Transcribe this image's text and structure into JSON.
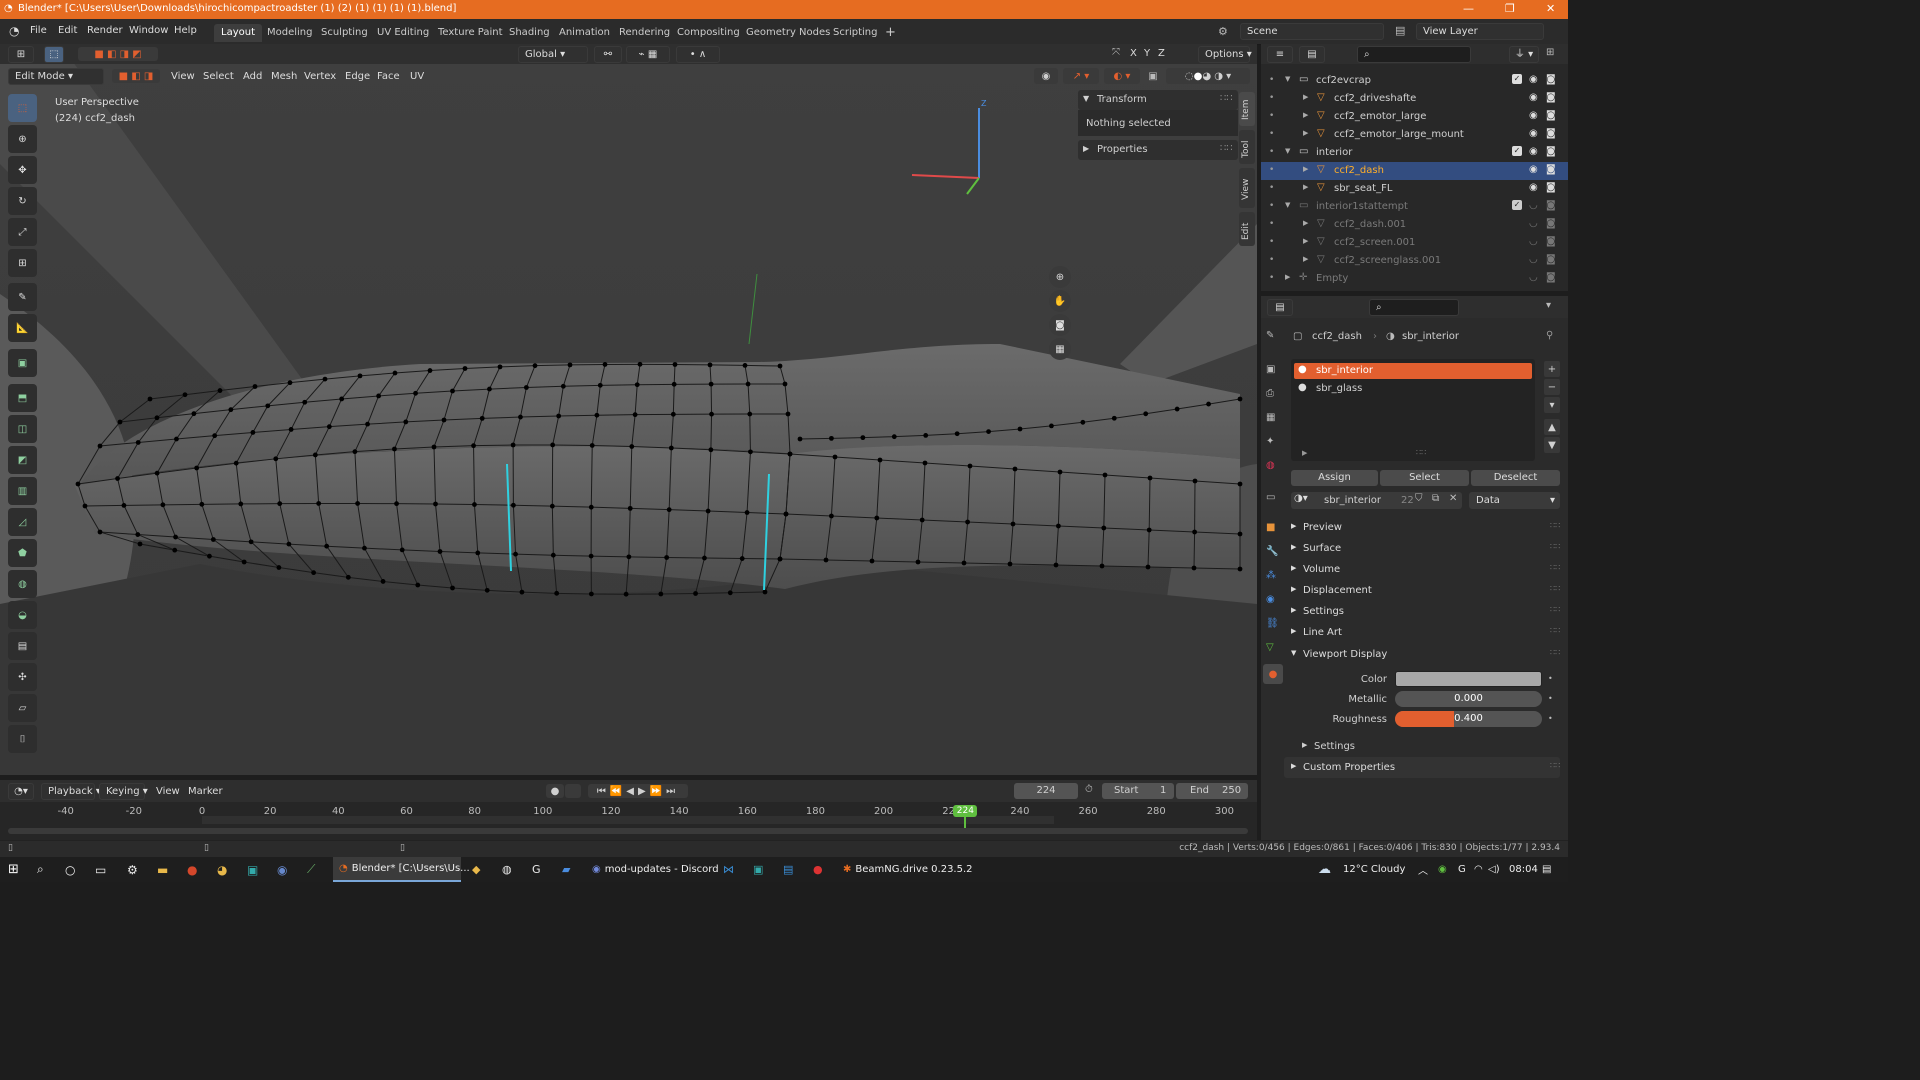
{
  "window": {
    "title": "Blender* [C:\\Users\\User\\Downloads\\hirochicompactroadster (1) (2) (1) (1) (1) (1).blend]"
  },
  "menu": [
    "File",
    "Edit",
    "Render",
    "Window",
    "Help"
  ],
  "workspaces": [
    "Layout",
    "Modeling",
    "Sculpting",
    "UV Editing",
    "Texture Paint",
    "Shading",
    "Animation",
    "Rendering",
    "Compositing",
    "Geometry Nodes",
    "Scripting"
  ],
  "active_workspace": "Layout",
  "scene": {
    "name": "Scene",
    "view_layer": "View Layer"
  },
  "viewport": {
    "mode": "Edit Mode",
    "header_menus": [
      "View",
      "Select",
      "Add",
      "Mesh",
      "Vertex",
      "Edge",
      "Face",
      "UV"
    ],
    "orientation": "Global",
    "axes": [
      "X",
      "Y",
      "Z"
    ],
    "options_label": "Options",
    "overlay_title": "User Perspective",
    "overlay_object": "(224) ccf2_dash"
  },
  "npanel": {
    "transform": "Transform",
    "nothing_selected": "Nothing selected",
    "properties": "Properties",
    "tabs": [
      "Item",
      "Tool",
      "View",
      "Edit"
    ]
  },
  "outliner": {
    "rows": [
      {
        "name": "ccf2evcrap",
        "kind": "collection",
        "indent": 0,
        "open": true
      },
      {
        "name": "ccf2_driveshafte",
        "kind": "mesh",
        "indent": 1
      },
      {
        "name": "ccf2_emotor_large",
        "kind": "mesh",
        "indent": 1
      },
      {
        "name": "ccf2_emotor_large_mount",
        "kind": "mesh",
        "indent": 1
      },
      {
        "name": "interior",
        "kind": "collection",
        "indent": 0,
        "open": true
      },
      {
        "name": "ccf2_dash",
        "kind": "mesh",
        "indent": 1,
        "active": true
      },
      {
        "name": "sbr_seat_FL",
        "kind": "mesh",
        "indent": 1
      },
      {
        "name": "interior1stattempt",
        "kind": "collection",
        "indent": 0,
        "open": true,
        "dim": true
      },
      {
        "name": "ccf2_dash.001",
        "kind": "mesh",
        "indent": 1,
        "dim": true
      },
      {
        "name": "ccf2_screen.001",
        "kind": "mesh",
        "indent": 1,
        "dim": true
      },
      {
        "name": "ccf2_screenglass.001",
        "kind": "mesh",
        "indent": 1,
        "dim": true
      },
      {
        "name": "Empty",
        "kind": "empty",
        "indent": 0,
        "dim": true
      }
    ]
  },
  "properties": {
    "breadcrumb_object": "ccf2_dash",
    "breadcrumb_material": "sbr_interior",
    "slots": [
      {
        "name": "sbr_interior",
        "selected": true
      },
      {
        "name": "sbr_glass",
        "selected": false
      }
    ],
    "assign": "Assign",
    "select": "Select",
    "deselect": "Deselect",
    "material_name": "sbr_interior",
    "users": "22",
    "link": "Data",
    "sections": [
      "Preview",
      "Surface",
      "Volume",
      "Displacement",
      "Settings",
      "Line Art"
    ],
    "viewport_display": "Viewport Display",
    "color_label": "Color",
    "metallic_label": "Metallic",
    "metallic_value": "0.000",
    "metallic_fraction": 0.0,
    "roughness_label": "Roughness",
    "roughness_value": "0.400",
    "roughness_fraction": 0.4,
    "sub_settings": "Settings",
    "custom_props": "Custom Properties"
  },
  "timeline": {
    "menus": [
      "Playback",
      "Keying",
      "View",
      "Marker"
    ],
    "current_frame": "224",
    "start_label": "Start",
    "start": "1",
    "end_label": "End",
    "end": "250",
    "ticks": [
      "-40",
      "-20",
      "0",
      "20",
      "40",
      "60",
      "80",
      "100",
      "120",
      "140",
      "160",
      "180",
      "200",
      "220",
      "240",
      "260",
      "280",
      "300"
    ],
    "playhead": 224
  },
  "statusbar": {
    "stats": "ccf2_dash | Verts:0/456 | Edges:0/861 | Faces:0/406 | Tris:830 | Objects:1/77 | 2.93.4"
  },
  "taskbar": {
    "apps": [
      {
        "label": "Blender* [C:\\Users\\Us...",
        "active": true
      },
      {
        "label": "mod-updates - Discord",
        "active": false
      },
      {
        "label": "BeamNG.drive 0.23.5.2",
        "active": false
      }
    ],
    "weather": "12°C  Cloudy",
    "time": "08:04"
  },
  "colors": {
    "accent": "#e66c21",
    "selection": "#e25f2f",
    "active_text": "#ffaf29",
    "seam": "#2fd1e0"
  }
}
